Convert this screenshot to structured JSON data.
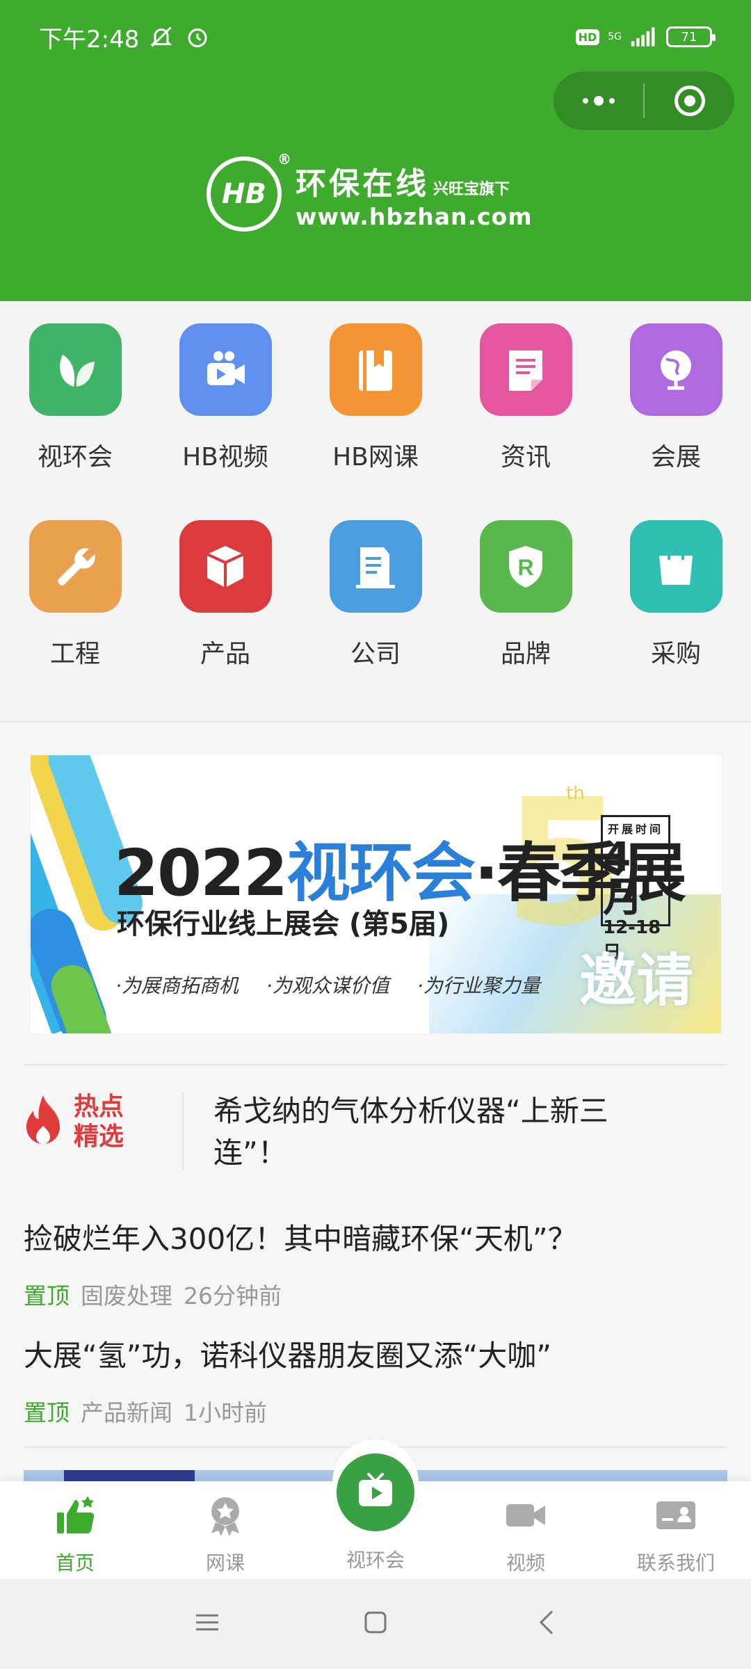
{
  "status_bar": {
    "time": "下午2:48",
    "network": "5G",
    "hd": "HD",
    "battery": "71"
  },
  "header": {
    "brand_logo_text": "HB",
    "brand_registered": "®",
    "brand_name": "环保在线",
    "brand_sub": "兴旺宝旗下",
    "brand_url": "www.hbzhan.com",
    "bg_color": "#3fab2e"
  },
  "grid": {
    "items": [
      {
        "label": "视环会",
        "icon": "leaf-icon",
        "color": "#3fb468"
      },
      {
        "label": "HB视频",
        "icon": "video-camera-icon",
        "color": "#5f90f0"
      },
      {
        "label": "HB网课",
        "icon": "book-icon",
        "color": "#f49434"
      },
      {
        "label": "资讯",
        "icon": "document-icon",
        "color": "#e4579f"
      },
      {
        "label": "会展",
        "icon": "globe-icon",
        "color": "#b06ae0"
      },
      {
        "label": "工程",
        "icon": "wrench-icon",
        "color": "#e9a14e"
      },
      {
        "label": "产品",
        "icon": "cube-icon",
        "color": "#dc3a3d"
      },
      {
        "label": "公司",
        "icon": "building-icon",
        "color": "#4a9ee0"
      },
      {
        "label": "品牌",
        "icon": "shield-r-icon",
        "color": "#58b84b"
      },
      {
        "label": "采购",
        "icon": "shopping-bag-icon",
        "color": "#2fbfb0"
      }
    ]
  },
  "banner": {
    "year": "2022",
    "title_highlight": "视环会",
    "title_rest": "·春季展",
    "subtitle": "环保行业线上展会 (第5届)",
    "tags": [
      "·为展商拓商机",
      "·为观众谋价值",
      "·为行业聚力量"
    ],
    "edition": "5",
    "edition_suffix": "th",
    "date_label": "开展时间",
    "date_month": "4月",
    "date_range": "12-18日",
    "invite": "邀请"
  },
  "hot": {
    "label_line1": "热点",
    "label_line2": "精选",
    "title": "希戈纳的气体分析仪器“上新三连”！"
  },
  "news": [
    {
      "title": "捡破烂年入300亿！其中暗藏环保“天机”？",
      "pin": "置顶",
      "category": "固废处理",
      "time": "26分钟前"
    },
    {
      "title": "大展“氢”功，诺科仪器朋友圈又添“大咖”",
      "pin": "置顶",
      "category": "产品新闻",
      "time": "1小时前"
    }
  ],
  "tabbar": {
    "tabs": [
      {
        "label": "首页",
        "icon": "thumbs-up-icon"
      },
      {
        "label": "网课",
        "icon": "medal-icon"
      },
      {
        "label": "视环会",
        "icon": "tv-play-icon"
      },
      {
        "label": "视频",
        "icon": "video-icon"
      },
      {
        "label": "联系我们",
        "icon": "contact-card-icon"
      }
    ],
    "active_color": "#3fab2e"
  }
}
